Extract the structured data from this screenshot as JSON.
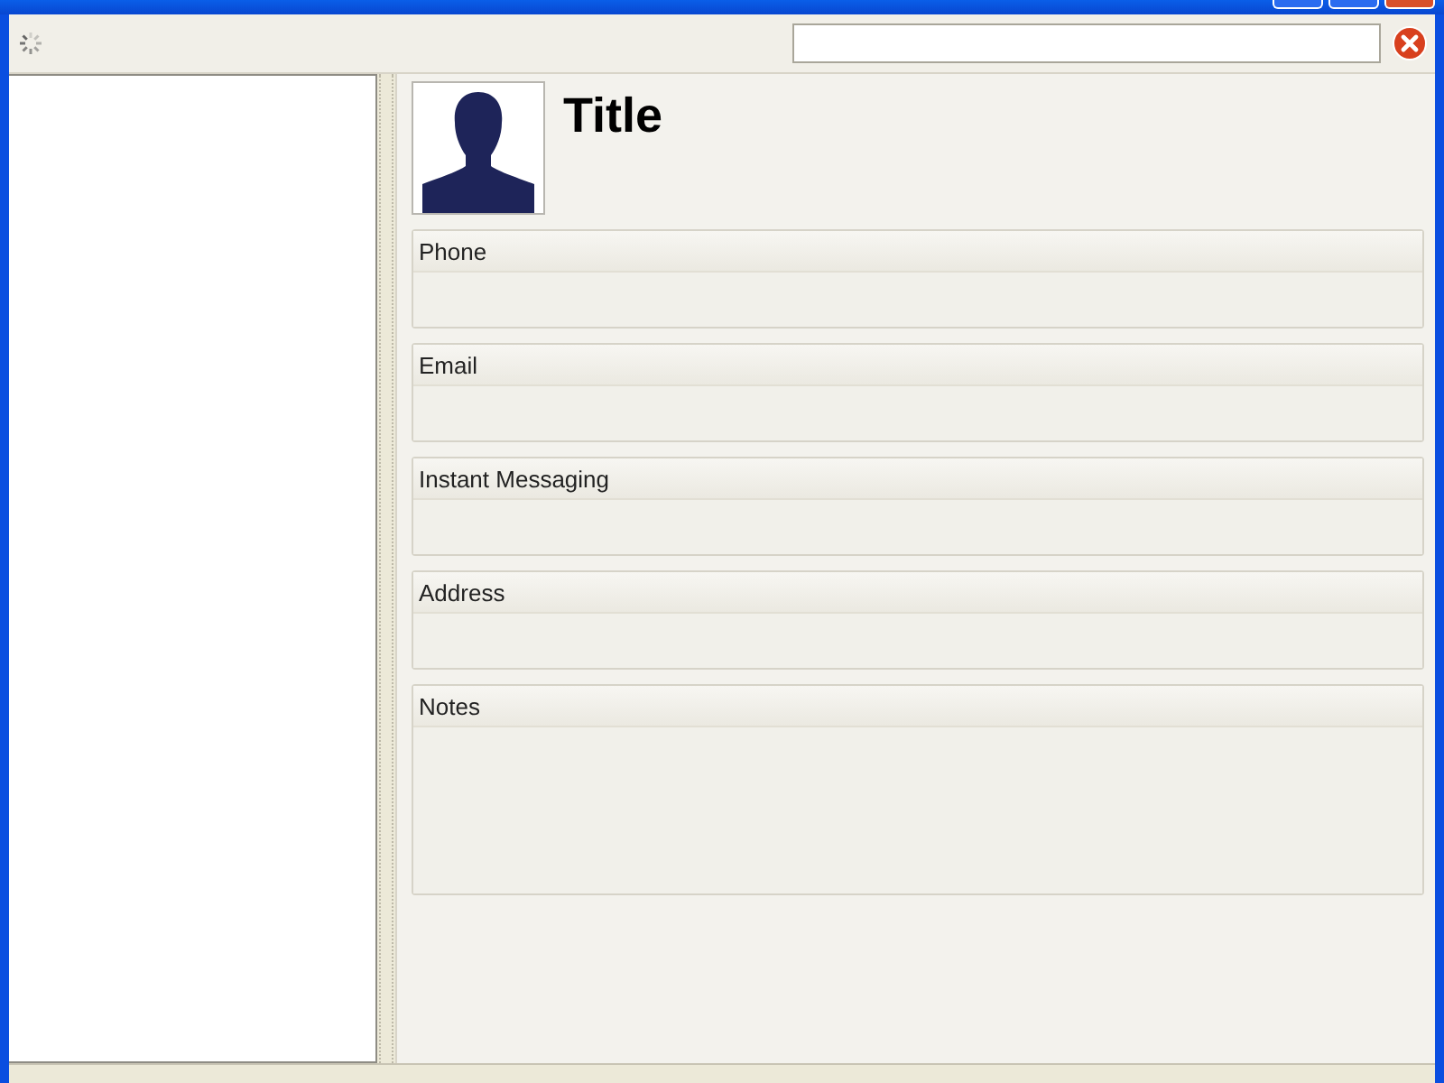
{
  "contact": {
    "title": "Title",
    "sections": [
      {
        "label": "Phone",
        "kind": "field"
      },
      {
        "label": "Email",
        "kind": "field"
      },
      {
        "label": "Instant Messaging",
        "kind": "field"
      },
      {
        "label": "Address",
        "kind": "field"
      },
      {
        "label": "Notes",
        "kind": "notes"
      }
    ]
  }
}
